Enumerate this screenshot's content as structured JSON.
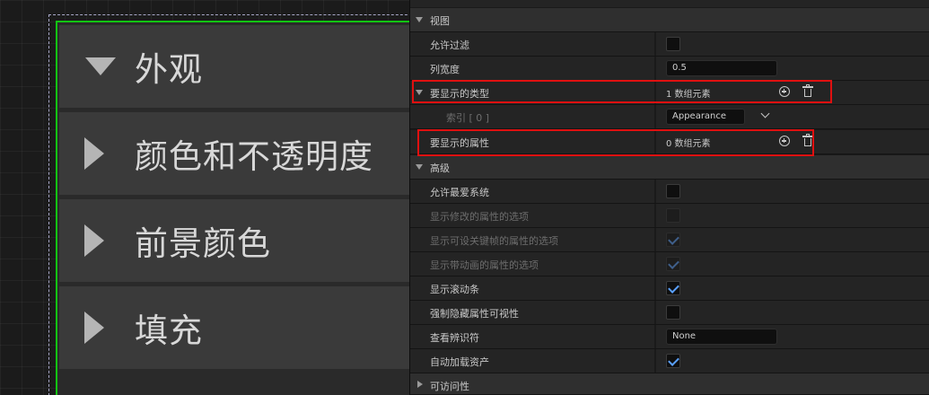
{
  "canvas": {
    "categories": [
      {
        "label": "外观",
        "expanded": true
      },
      {
        "label": "颜色和不透明度",
        "expanded": false
      },
      {
        "label": "前景颜色",
        "expanded": false
      },
      {
        "label": "填充",
        "expanded": false
      }
    ]
  },
  "details": {
    "view_section": "视图",
    "allow_filter": "允许过滤",
    "column_width": "列宽度",
    "column_width_value": "0.5",
    "types_to_show": "要显示的类型",
    "types_to_show_count": "1 数组元素",
    "index_label": "索引 [ 0 ]",
    "index_value": "Appearance",
    "properties_to_show": "要显示的属性",
    "properties_to_show_count": "0 数组元素",
    "advanced_section": "高级",
    "allow_favorites": "允许最爱系统",
    "show_modified_option": "显示修改的属性的选项",
    "show_keyable_option": "显示可设关键帧的属性的选项",
    "show_animated_option": "显示带动画的属性的选项",
    "show_scrollbar": "显示滚动条",
    "force_hidden_visibility": "强制隐藏属性可视性",
    "view_identifier": "查看辨识符",
    "view_identifier_value": "None",
    "auto_load_assets": "自动加载资产",
    "accessibility_section": "可访问性"
  },
  "colors": {
    "selection_green": "#12c412",
    "highlight_red": "#e01010",
    "check_blue": "#5aa0ff"
  }
}
